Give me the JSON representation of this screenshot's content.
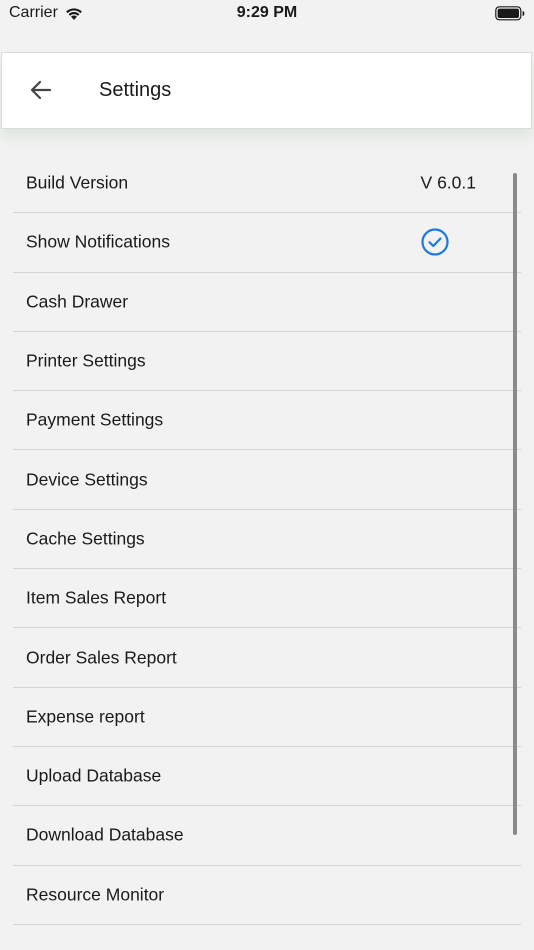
{
  "status_bar": {
    "carrier": "Carrier",
    "time": "9:29 PM"
  },
  "header": {
    "title": "Settings",
    "back_icon": "arrow-left-icon"
  },
  "settings": [
    {
      "label": "Build Version",
      "value": "V 6.0.1"
    },
    {
      "label": "Show Notifications",
      "checked": true,
      "icon": "check-circle-icon"
    },
    {
      "label": "Cash Drawer"
    },
    {
      "label": "Printer Settings"
    },
    {
      "label": "Payment Settings"
    },
    {
      "label": "Device Settings"
    },
    {
      "label": "Cache Settings"
    },
    {
      "label": "Item Sales Report"
    },
    {
      "label": "Order Sales Report"
    },
    {
      "label": "Expense report"
    },
    {
      "label": "Upload Database"
    },
    {
      "label": "Download Database"
    },
    {
      "label": "Resource Monitor"
    }
  ],
  "colors": {
    "accent": "#1a7ae0",
    "background": "#f2f2f2",
    "header_background": "#ffffff",
    "divider": "#d4d4d4"
  }
}
